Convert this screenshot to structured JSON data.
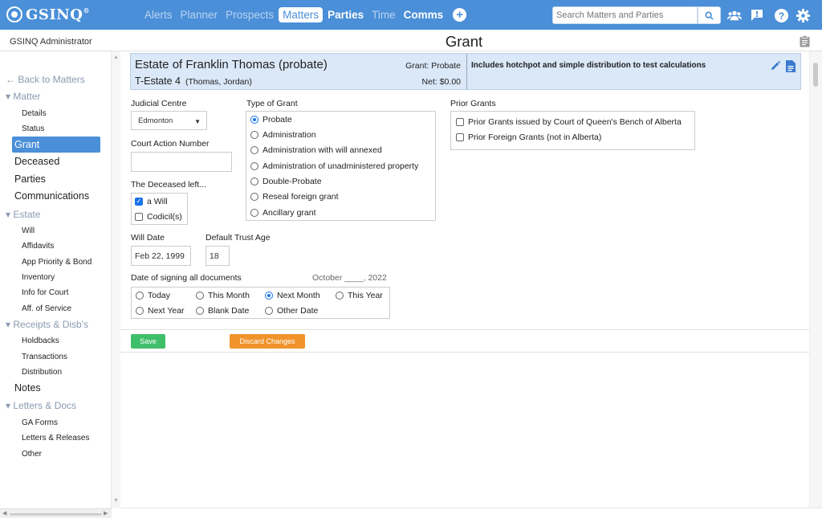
{
  "app": {
    "logo": "GSINQ",
    "logo_mark": "®",
    "nav": [
      "Alerts",
      "Planner",
      "Prospects",
      "Matters",
      "Parties",
      "Time",
      "Comms"
    ],
    "search_placeholder": "Search Matters and Parties",
    "colors": {
      "topbar": "#4a8fd8",
      "active": "#4a8fd8",
      "save": "#3fbf6a",
      "discard": "#f0932b"
    },
    "icons": [
      "add-icon",
      "search-icon",
      "users-icon",
      "chat-icon",
      "help-icon",
      "settings-icon"
    ]
  },
  "header": {
    "user": "GSINQ Administrator",
    "title": "Grant"
  },
  "sidebar": {
    "back": "← Back to Matters",
    "matter": "▾ Matter",
    "details": "Details",
    "status": "Status",
    "grant": "Grant",
    "deceased": "Deceased",
    "parties": "Parties",
    "communications": "Communications",
    "estate": "▾ Estate",
    "will": "Will",
    "affidavits": "Affidavits",
    "app_priority": "App Priority & Bond",
    "inventory": "Inventory",
    "info_court": "Info for Court",
    "aff_service": "Aff. of Service",
    "receipts": "▾ Receipts & Disb's",
    "holdbacks": "Holdbacks",
    "transactions": "Transactions",
    "distribution": "Distribution",
    "notes": "Notes",
    "letters": "▾ Letters & Docs",
    "ga_forms": "GA Forms",
    "letters_releases": "Letters & Releases",
    "other": "Other"
  },
  "estate": {
    "name": "Estate of Franklin Thomas (probate)",
    "code": "T-Estate 4",
    "parties": "(Thomas, Jordan)",
    "grant": "Grant: Probate",
    "net": "Net: $0.00",
    "note": "Includes hotchpot and simple distribution to test calculations"
  },
  "form": {
    "judicial_centre_label": "Judicial Centre",
    "judicial_centre_value": "Edmonton",
    "court_action_label": "Court Action Number",
    "court_action_value": "",
    "deceased_left_label": "The Deceased left...",
    "will_label": "a Will",
    "codicil_label": "Codicil(s)",
    "type_of_grant_label": "Type of Grant",
    "grant_types": [
      "Probate",
      "Administration",
      "Administration with will annexed",
      "Administration of unadministered property",
      "Double-Probate",
      "Reseal foreign grant",
      "Ancillary grant"
    ],
    "prior_grants_label": "Prior Grants",
    "prior_grants": [
      "Prior Grants issued by Court of Queen's Bench of Alberta",
      "Prior Foreign Grants (not in Alberta)"
    ],
    "will_date_label": "Will Date",
    "will_date_value": "Feb 22, 1999",
    "trust_age_label": "Default Trust Age",
    "trust_age_value": "18",
    "signing_label": "Date of signing all documents",
    "signing_preview": "October ____, 2022",
    "signing_options": [
      "Today",
      "This Month",
      "Next Month",
      "This Year",
      "Next Year",
      "Blank Date",
      "Other Date"
    ],
    "save_label": "Save",
    "discard_label": "Discard Changes"
  }
}
